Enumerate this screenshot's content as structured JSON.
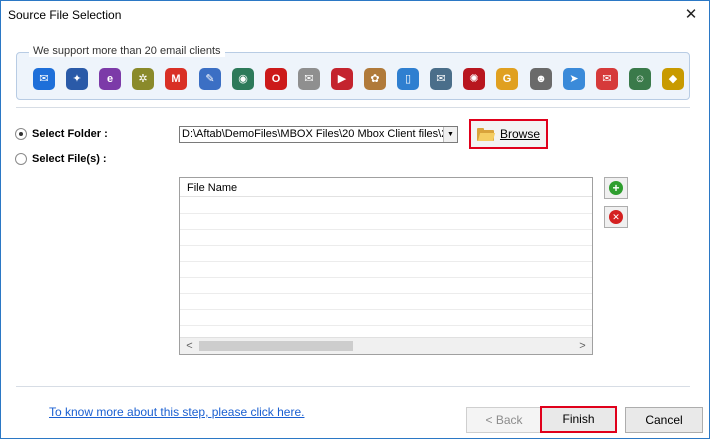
{
  "window": {
    "title": "Source File Selection",
    "close_glyph": "✕"
  },
  "clients": {
    "group_label": "We support more than 20 email clients",
    "icons": [
      {
        "name": "mail-app-icon",
        "glyph": "✉",
        "color": "#1e6fd9"
      },
      {
        "name": "thunderbird-icon",
        "glyph": "✦",
        "color": "#2a5aa8"
      },
      {
        "name": "eudora-icon",
        "glyph": "e",
        "color": "#7c3aa8"
      },
      {
        "name": "spicebird-icon",
        "glyph": "✲",
        "color": "#8a8a2a"
      },
      {
        "name": "gmail-icon",
        "glyph": "M",
        "color": "#d93025"
      },
      {
        "name": "postbox-icon",
        "glyph": "✎",
        "color": "#3b6fc4"
      },
      {
        "name": "seamonkey-icon",
        "glyph": "◉",
        "color": "#2d7a5a"
      },
      {
        "name": "opera-mail-icon",
        "glyph": "O",
        "color": "#cc1a1a"
      },
      {
        "name": "claws-mail-icon",
        "glyph": "✉",
        "color": "#8f8f8f"
      },
      {
        "name": "mulberry-icon",
        "glyph": "▶",
        "color": "#c4242e"
      },
      {
        "name": "sylpheed-icon",
        "glyph": "✿",
        "color": "#b07a3a"
      },
      {
        "name": "netscape-icon",
        "glyph": "▯",
        "color": "#2f7fd0"
      },
      {
        "name": "pocomail-icon",
        "glyph": "✉",
        "color": "#4a6e8a"
      },
      {
        "name": "opera-red-icon",
        "glyph": "✺",
        "color": "#b8161f"
      },
      {
        "name": "gyazmail-icon",
        "glyph": "G",
        "color": "#e0a020"
      },
      {
        "name": "gnu-icon",
        "glyph": "☻",
        "color": "#6a6a6a"
      },
      {
        "name": "mailcopa-icon",
        "glyph": "➤",
        "color": "#3a8ad9"
      },
      {
        "name": "apple-mail-icon",
        "glyph": "✉",
        "color": "#d63a3a"
      },
      {
        "name": "mozilla-icon",
        "glyph": "☺",
        "color": "#3a7a4a"
      },
      {
        "name": "the-bat-icon",
        "glyph": "◆",
        "color": "#c89a00"
      }
    ]
  },
  "source": {
    "select_folder_label": "Select Folder :",
    "select_files_label": "Select File(s) :",
    "folder_path": "D:\\Aftab\\DemoFiles\\MBOX Files\\20 Mbox Client files\\2",
    "browse_label": "Browse"
  },
  "file_list": {
    "header": "File Name",
    "scroll_left": "<",
    "scroll_right": ">"
  },
  "side_buttons": {
    "add_glyph": "+",
    "remove_glyph": "✕"
  },
  "footer": {
    "help_link": "To know more about this step, please click here.",
    "back_label": "< Back",
    "finish_label": "Finish",
    "cancel_label": "Cancel"
  },
  "colors": {
    "accent_border": "#e0001b",
    "link": "#1a5fd1",
    "window_border": "#2b78c5",
    "add_green": "#2e9e2e",
    "remove_red": "#d42020"
  }
}
